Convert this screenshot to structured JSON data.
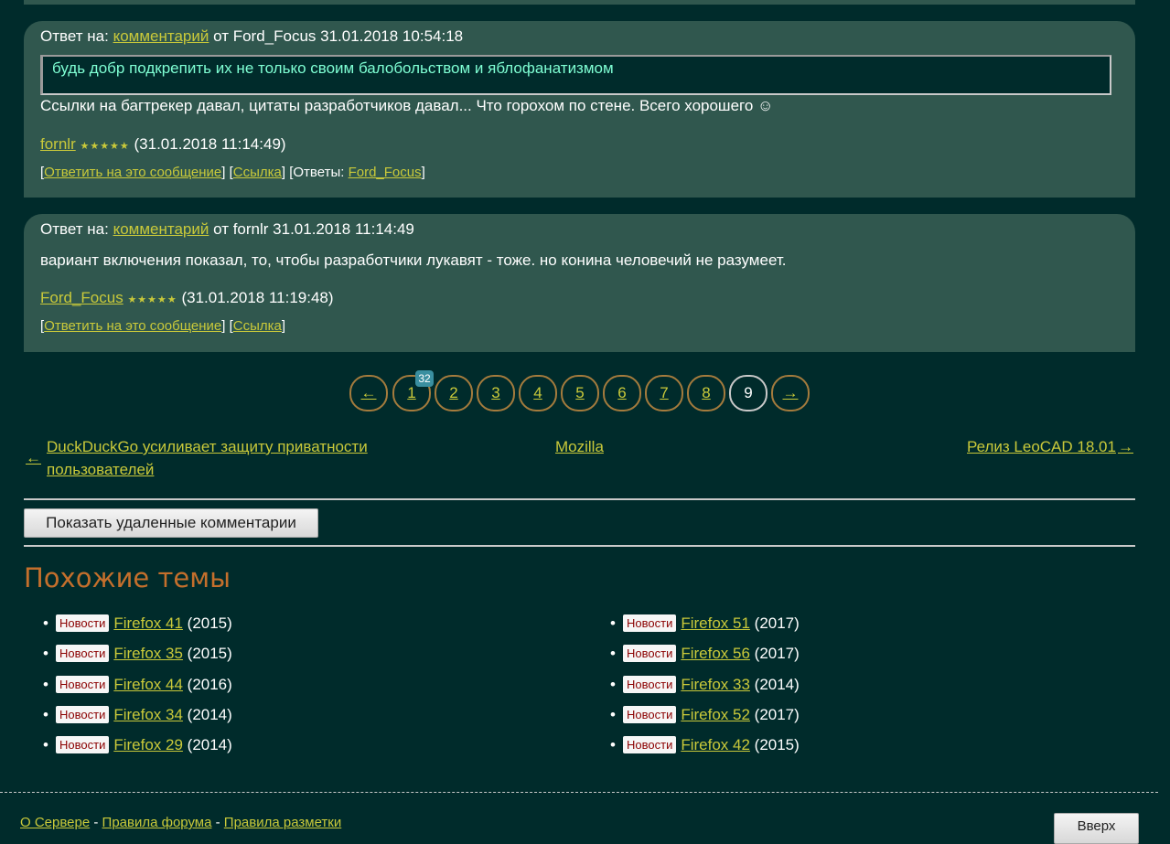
{
  "messages": [
    {
      "reply_prefix": "Ответ на:",
      "reply_link": "комментарий",
      "reply_suffix": "от Ford_Focus 31.01.2018 10:54:18",
      "quote": "будь добр подкрепить их не только своим балобольством и яблофанатизмом",
      "body": "Ссылки на багтрекер давал, цитаты разработчиков давал... Что горохом по стене. Всего хорошего ☺",
      "author": "fornlr",
      "stars": "★★★★★",
      "time": "(31.01.2018 11:14:49)",
      "reply_action": "Ответить на это сообщение",
      "link_action": "Ссылка",
      "answers_label": "[Ответы:",
      "answers_link": "Ford_Focus"
    },
    {
      "reply_prefix": "Ответ на:",
      "reply_link": "комментарий",
      "reply_suffix": "от fornlr 31.01.2018 11:14:49",
      "body": "вариант включения показал, то, чтобы разработчики лукавят - тоже. но конина человечий не разумеет.",
      "author": "Ford_Focus",
      "stars": "★★★★★",
      "time": "(31.01.2018 11:19:48)",
      "reply_action": "Ответить на это сообщение",
      "link_action": "Ссылка"
    }
  ],
  "pagination": {
    "prev": "←",
    "pages": [
      "1",
      "2",
      "3",
      "4",
      "5",
      "6",
      "7",
      "8",
      "9"
    ],
    "current": "9",
    "next": "→",
    "badge": "32"
  },
  "nav": {
    "prev_arrow": "←",
    "prev_title_1": "DuckDuckGo усиливает защиту приватности",
    "prev_title_2": "пользователей",
    "category": "Mozilla",
    "next_title": "Релиз LeoCAD 18.01",
    "next_arrow": "→"
  },
  "show_deleted_button": "Показать удаленные комментарии",
  "similar": {
    "title": "Похожие темы",
    "tag": "Новости",
    "left": [
      {
        "name": "Firefox 41",
        "year": "(2015)"
      },
      {
        "name": "Firefox 35",
        "year": "(2015)"
      },
      {
        "name": "Firefox 44",
        "year": "(2016)"
      },
      {
        "name": "Firefox 34",
        "year": "(2014)"
      },
      {
        "name": "Firefox 29",
        "year": "(2014)"
      }
    ],
    "right": [
      {
        "name": "Firefox 51",
        "year": "(2017)"
      },
      {
        "name": "Firefox 56",
        "year": "(2017)"
      },
      {
        "name": "Firefox 33",
        "year": "(2014)"
      },
      {
        "name": "Firefox 52",
        "year": "(2017)"
      },
      {
        "name": "Firefox 42",
        "year": "(2015)"
      }
    ]
  },
  "footer": {
    "about": "О Сервере",
    "sep": "-",
    "rules": "Правила форума",
    "markup": "Правила разметки",
    "up_button": "Вверх"
  },
  "colors": {
    "background": "#002b2b",
    "message_bg": "#30574e",
    "link": "#c9c93a",
    "heading": "#c46f2c",
    "tag_text": "#8b0000"
  }
}
